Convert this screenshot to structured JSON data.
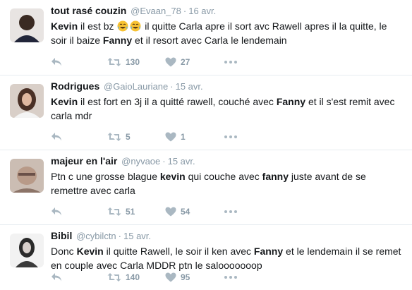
{
  "tweets": [
    {
      "name": "tout rasé couzin",
      "handle": "@Evaan_78",
      "date": "16 avr.",
      "text_parts": [
        "Kevin",
        " il est bz ",
        "",
        " il quitte Carla apre il sort avc Rawell apres il la quitte, le soir il baize ",
        "Fanny",
        " et il resort avec Carla le lendemain"
      ],
      "retweets": "130",
      "likes": "27",
      "avatar_color": "#3a2a22"
    },
    {
      "name": "Rodrigues",
      "handle": "@GaioLauriane",
      "date": "15 avr.",
      "text_parts": [
        "Kevin",
        " il est fort en 3j il a quitté rawell, couché avec ",
        "Fanny",
        " et il s'est remit avec carla mdr"
      ],
      "retweets": "5",
      "likes": "1",
      "avatar_color": "#6b4a3a"
    },
    {
      "name": "majeur en l'air",
      "handle": "@nyvaoe",
      "date": "15 avr.",
      "text_parts": [
        "Ptn c une grosse blague ",
        "kevin",
        " qui couche avec ",
        "fanny",
        " juste avant de se remettre avec carla"
      ],
      "retweets": "51",
      "likes": "54",
      "avatar_color": "#b89a88"
    },
    {
      "name": "Bibil",
      "handle": "@cybilctn",
      "date": "15 avr.",
      "text_parts": [
        "Donc ",
        "Kevin",
        " il quitte Rawell, le soir il ken avec ",
        "Fanny",
        " et le lendemain il se remet en couple avec Carla MDDR ptn le salooooooop"
      ],
      "retweets": "140",
      "likes": "95",
      "avatar_color": "#d8d8d8"
    }
  ],
  "icons": {
    "reply": "reply-arrow-icon",
    "retweet": "retweet-icon",
    "like": "heart-icon",
    "more": "more-dots-icon",
    "emoji": "tears-of-joy-emoji"
  },
  "colors": {
    "text": "#14171a",
    "muted": "#8899a6",
    "icon": "#aab8c2",
    "divider": "#e6ecf0"
  },
  "dot": "·"
}
